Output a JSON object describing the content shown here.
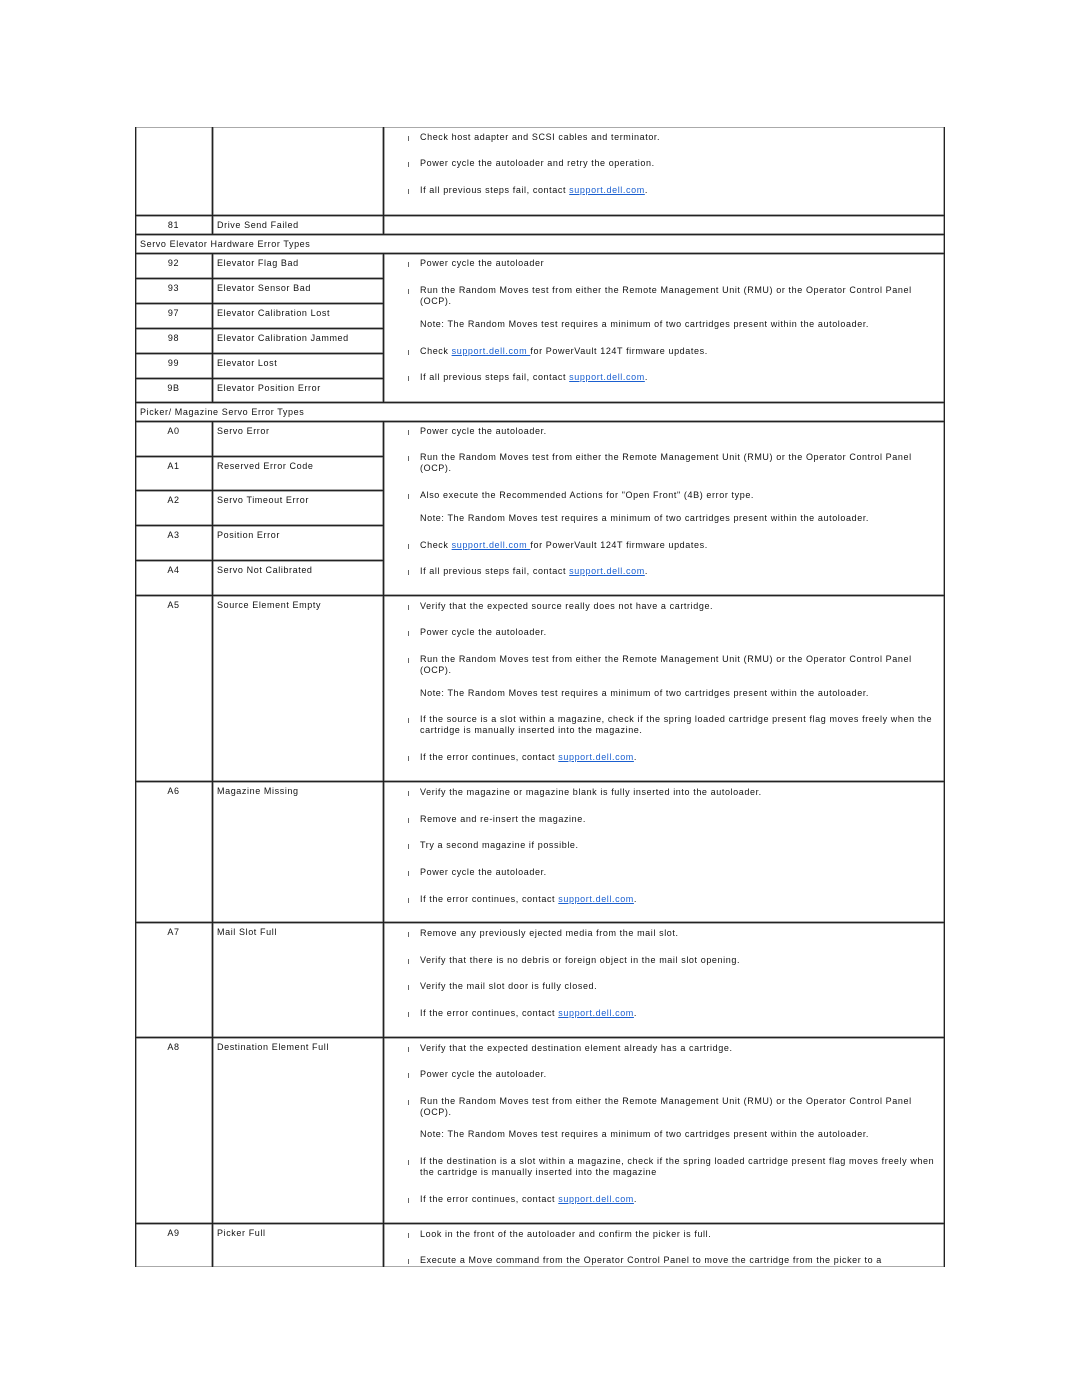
{
  "link_color": "#1a5fd0",
  "table": {
    "blocks": [
      {
        "type": "group",
        "entries": [],
        "steps": [
          {
            "kind": "bullet",
            "text": "Check host adapter and SCSI cables and terminator."
          },
          {
            "kind": "bullet",
            "text": "Power cycle the autoloader and retry the operation."
          },
          {
            "kind": "bullet",
            "text": "If all previous steps fail, contact ",
            "link": "support.dell.com",
            "after": "."
          }
        ]
      },
      {
        "type": "group",
        "entries": [
          {
            "code": "81",
            "description": "Drive Send Failed"
          }
        ],
        "steps": []
      },
      {
        "type": "section",
        "title": "Servo Elevator Hardware Error Types"
      },
      {
        "type": "group",
        "entries": [
          {
            "code": "92",
            "description": "Elevator Flag Bad"
          },
          {
            "code": "93",
            "description": "Elevator Sensor Bad"
          },
          {
            "code": "97",
            "description": "Elevator Calibration Lost"
          },
          {
            "code": "98",
            "description": "Elevator Calibration Jammed"
          },
          {
            "code": "99",
            "description": "Elevator Lost"
          },
          {
            "code": "9B",
            "description": "Elevator Position Error"
          }
        ],
        "steps": [
          {
            "kind": "bullet",
            "text": "Power cycle the autoloader"
          },
          {
            "kind": "bullet",
            "text": "Run the Random Moves test from either the Remote Management Unit (RMU) or the Operator Control Panel (OCP)."
          },
          {
            "kind": "note",
            "text": "Note: The Random Moves test requires a minimum of two cartridges present within the autoloader."
          },
          {
            "kind": "bullet",
            "text": "Check ",
            "link": "support.dell.com ",
            "after": "for PowerVault 124T firmware updates."
          },
          {
            "kind": "bullet",
            "text": "If all previous steps fail, contact ",
            "link": "support.dell.com",
            "after": "."
          }
        ]
      },
      {
        "type": "section",
        "title": "Picker/ Magazine Servo Error Types"
      },
      {
        "type": "group",
        "entries": [
          {
            "code": "A0",
            "description": "Servo Error"
          },
          {
            "code": "A1",
            "description": "Reserved Error Code"
          },
          {
            "code": "A2",
            "description": "Servo Timeout Error"
          },
          {
            "code": "A3",
            "description": "Position Error"
          },
          {
            "code": "A4",
            "description": "Servo Not Calibrated"
          }
        ],
        "steps": [
          {
            "kind": "bullet",
            "text": "Power cycle the autoloader."
          },
          {
            "kind": "bullet",
            "text": "Run the Random Moves test from either the Remote Management Unit (RMU) or the Operator Control Panel (OCP)."
          },
          {
            "kind": "bullet",
            "text": "Also execute the Recommended Actions for \"Open Front\" (4B) error type."
          },
          {
            "kind": "note",
            "text": "Note: The Random Moves test requires a minimum of two cartridges present within the autoloader."
          },
          {
            "kind": "bullet",
            "text": "Check ",
            "link": "support.dell.com ",
            "after": "for PowerVault 124T firmware updates."
          },
          {
            "kind": "bullet",
            "text": "If all previous steps fail, contact ",
            "link": "support.dell.com",
            "after": "."
          }
        ]
      },
      {
        "type": "group",
        "entries": [
          {
            "code": "A5",
            "description": "Source Element Empty"
          }
        ],
        "steps": [
          {
            "kind": "bullet",
            "text": "Verify that the expected source really does not have a cartridge."
          },
          {
            "kind": "bullet",
            "text": "Power cycle the autoloader."
          },
          {
            "kind": "bullet",
            "text": "Run the Random Moves test from either the Remote Management Unit (RMU) or the Operator Control Panel (OCP)."
          },
          {
            "kind": "note",
            "text": "Note: The Random Moves test requires a minimum of two cartridges present within the autoloader."
          },
          {
            "kind": "bullet",
            "text": "If the source is a slot within a magazine, check if the spring loaded cartridge present flag moves freely when the cartridge is manually inserted into the magazine."
          },
          {
            "kind": "bullet",
            "text": "If the error continues, contact ",
            "link": "support.dell.com",
            "after": "."
          }
        ]
      },
      {
        "type": "group",
        "entries": [
          {
            "code": "A6",
            "description": "Magazine Missing"
          }
        ],
        "steps": [
          {
            "kind": "bullet",
            "text": "Verify the magazine or magazine blank is fully inserted into the autoloader."
          },
          {
            "kind": "bullet",
            "text": "Remove and re-insert the magazine."
          },
          {
            "kind": "bullet",
            "text": "Try a second magazine if possible."
          },
          {
            "kind": "bullet",
            "text": "Power cycle the autoloader."
          },
          {
            "kind": "bullet",
            "text": "If the error continues, contact ",
            "link": "support.dell.com",
            "after": "."
          }
        ]
      },
      {
        "type": "group",
        "entries": [
          {
            "code": "A7",
            "description": "Mail Slot Full"
          }
        ],
        "steps": [
          {
            "kind": "bullet",
            "text": "Remove any previously ejected media from the mail slot."
          },
          {
            "kind": "bullet",
            "text": "Verify that there is no debris or foreign object in the mail slot opening."
          },
          {
            "kind": "bullet",
            "text": "Verify the mail slot door is fully closed."
          },
          {
            "kind": "bullet",
            "text": "If the error continues, contact ",
            "link": "support.dell.com",
            "after": "."
          }
        ]
      },
      {
        "type": "group",
        "entries": [
          {
            "code": "A8",
            "description": "Destination Element Full"
          }
        ],
        "steps": [
          {
            "kind": "bullet",
            "text": "Verify that the expected destination element already has a cartridge."
          },
          {
            "kind": "bullet",
            "text": "Power cycle the autoloader."
          },
          {
            "kind": "bullet",
            "text": "Run the Random Moves test from either the Remote Management Unit (RMU) or the Operator Control Panel (OCP)."
          },
          {
            "kind": "note",
            "text": "Note: The Random Moves test requires a minimum of two cartridges present within the autoloader."
          },
          {
            "kind": "bullet",
            "text": "If the destination is a slot within a magazine, check if the spring loaded cartridge present flag moves freely when the cartridge is manually inserted into the magazine"
          },
          {
            "kind": "bullet",
            "text": "If the error continues, contact ",
            "link": "support.dell.com",
            "after": "."
          }
        ]
      },
      {
        "type": "group",
        "entries": [
          {
            "code": "A9",
            "description": "Picker Full"
          }
        ],
        "steps": [
          {
            "kind": "bullet",
            "text": "Look in the front of the autoloader and confirm the picker is full."
          },
          {
            "kind": "bullet",
            "text": "Execute a Move command from the Operator Control Panel to move the cartridge from the picker to a"
          }
        ]
      }
    ]
  }
}
